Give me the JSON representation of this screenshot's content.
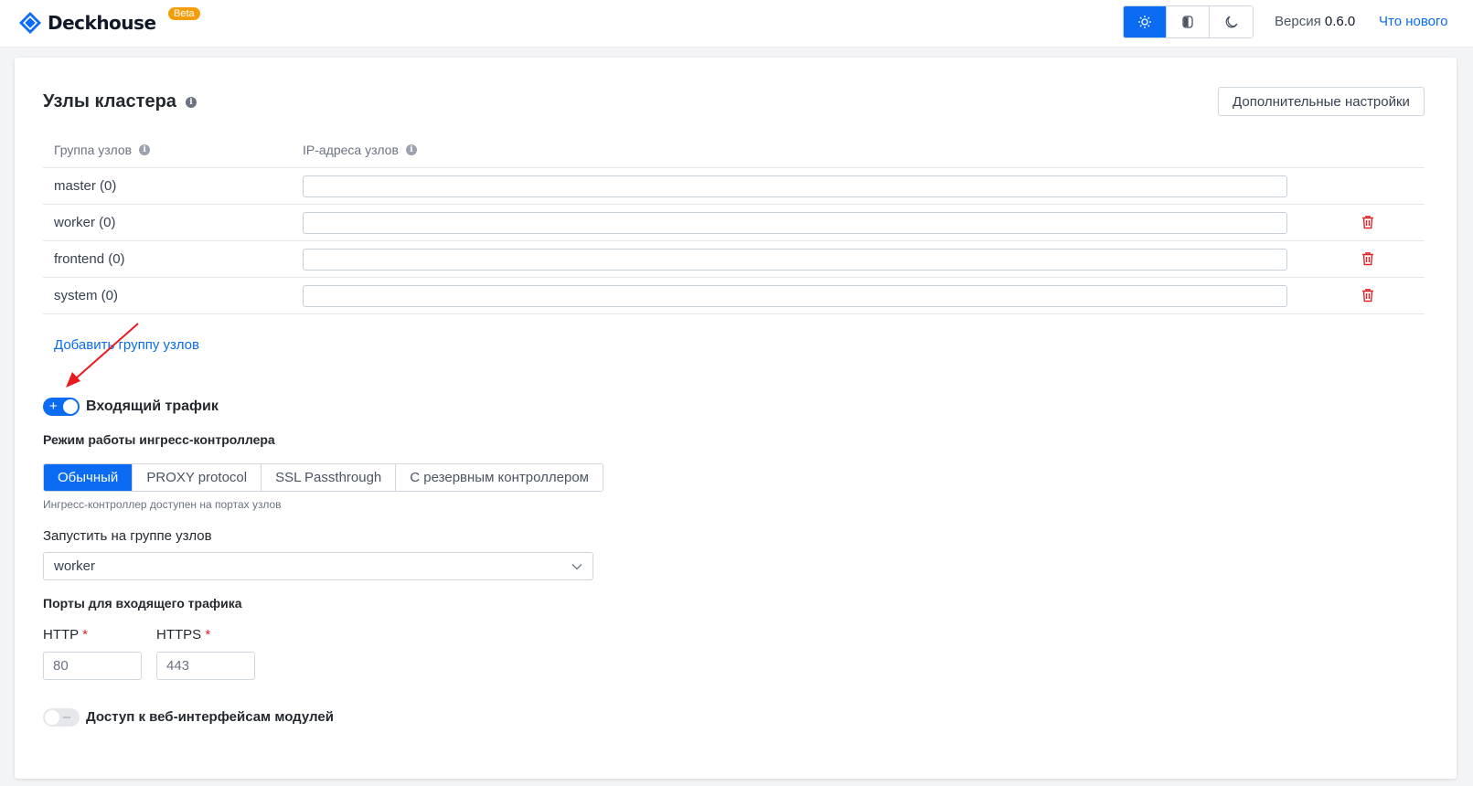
{
  "header": {
    "logo_text": "Deckhouse",
    "beta_badge": "Beta",
    "theme_buttons": [
      {
        "icon": "sun-icon",
        "active": true
      },
      {
        "icon": "auto-theme-icon",
        "active": false
      },
      {
        "icon": "moon-icon",
        "active": false
      }
    ],
    "version_label": "Версия",
    "version_value": "0.6.0",
    "whats_new": "Что нового"
  },
  "cluster": {
    "title": "Узлы кластера",
    "advanced_button": "Дополнительные настройки",
    "col_group": "Группа узлов",
    "col_ips": "IP-адреса узлов",
    "rows": [
      {
        "name": "master (0)",
        "ips": "",
        "deletable": false
      },
      {
        "name": "worker (0)",
        "ips": "",
        "deletable": true
      },
      {
        "name": "frontend (0)",
        "ips": "",
        "deletable": true
      },
      {
        "name": "system (0)",
        "ips": "",
        "deletable": true
      }
    ],
    "add_group_link": "Добавить группу узлов"
  },
  "ingress": {
    "toggle_label": "Входящий трафик",
    "toggle_on": true,
    "mode_label": "Режим работы ингресс-контроллера",
    "modes": [
      "Обычный",
      "PROXY protocol",
      "SSL Passthrough",
      "С резервным контроллером"
    ],
    "active_mode": "Обычный",
    "mode_hint": "Ингресс-контроллер доступен на портах узлов",
    "node_group_label": "Запустить на группе узлов",
    "node_group_value": "worker",
    "ports_label": "Порты для входящего трафика",
    "http_label": "HTTP",
    "http_value": "80",
    "https_label": "HTTPS",
    "https_value": "443",
    "required_mark": "*"
  },
  "web_access": {
    "toggle_label": "Доступ к веб-интерфейсам модулей",
    "toggle_on": false
  },
  "colors": {
    "accent": "#0b6cf3",
    "danger": "#dc2626",
    "annotation_arrow": "#e8191f",
    "beta_badge": "#f59e0b"
  }
}
